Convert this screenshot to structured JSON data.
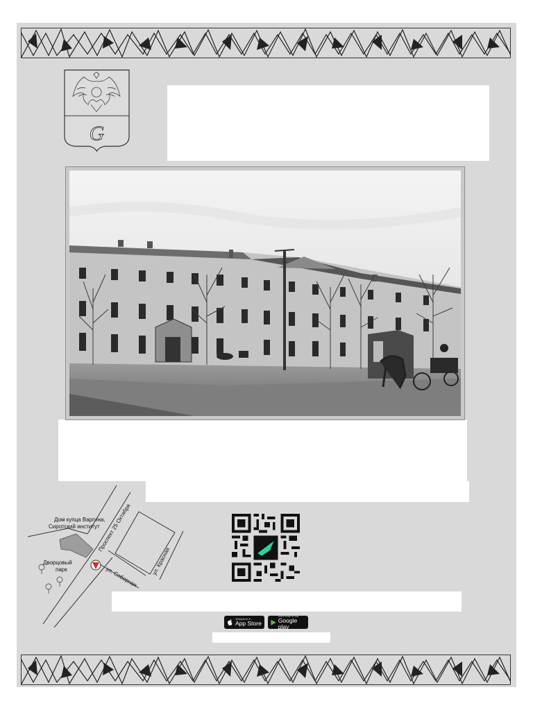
{
  "map": {
    "building_label_line1": "Дом купца Варгина,",
    "building_label_line2": "Сиротский институт",
    "park_label_line1": "Дворцовый",
    "park_label_line2": "парк",
    "street_prospekt": "Проспект 25 Октября",
    "street_sobornaya": "ул. Соборная",
    "street_krasnaya": "ул. Красная"
  },
  "coat_of_arms": {
    "letter": "G"
  },
  "app_links": {
    "appstore_small": "Загрузите в",
    "appstore_big": "App Store",
    "googleplay_small": "ЗАГРУЗИТЕ НА",
    "googleplay_big": "Google play"
  },
  "colors": {
    "poster_background": "#d9d9d9",
    "map_marker": "#d62b2b",
    "qr_logo": "#2fcf9e"
  },
  "icons": [
    "apple-icon",
    "google-play-icon",
    "map-pin-icon",
    "tree-icon",
    "coat-of-arms-icon",
    "qr-code-icon"
  ]
}
